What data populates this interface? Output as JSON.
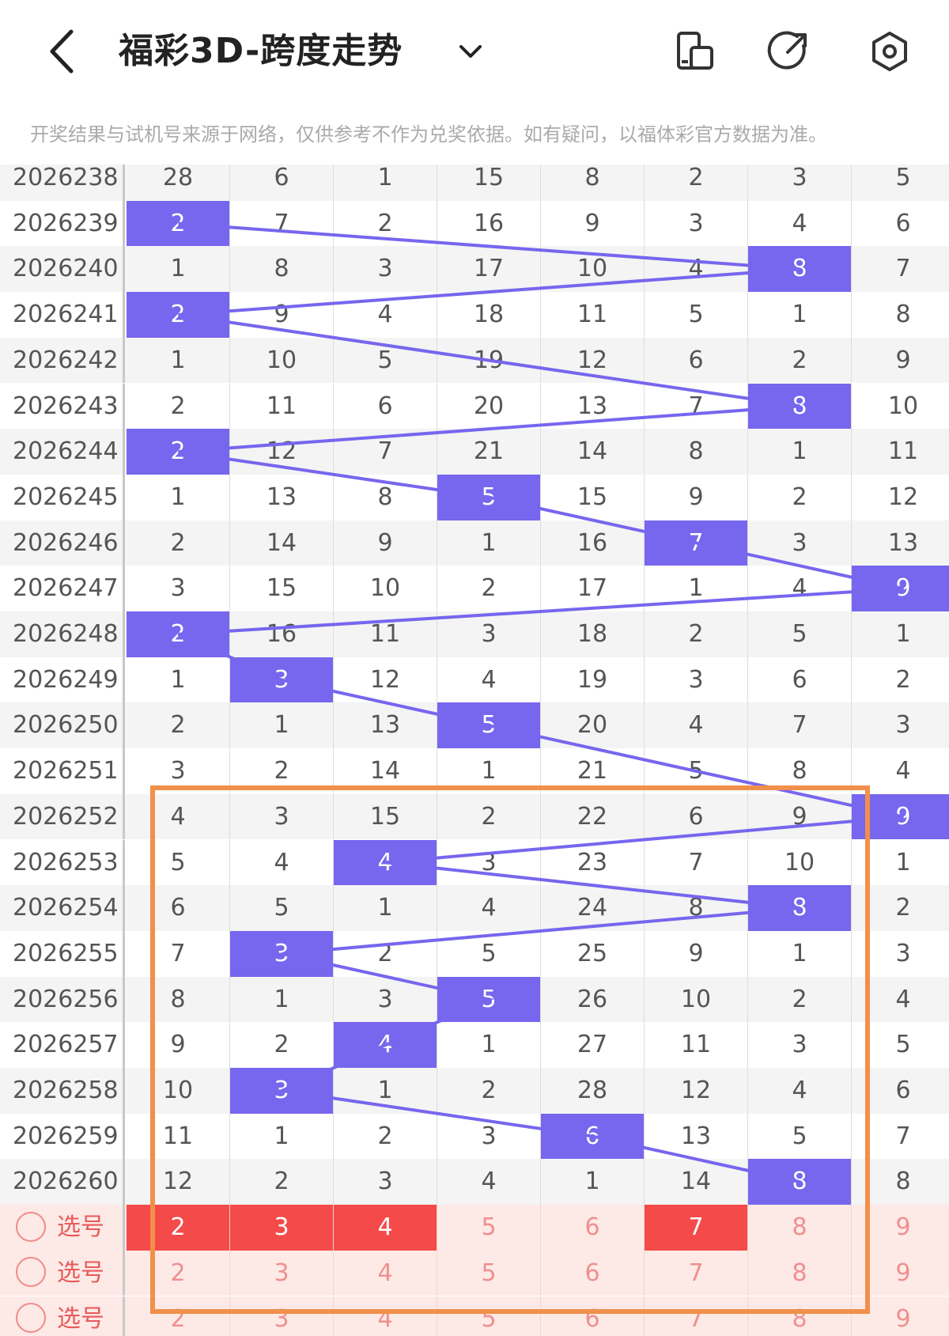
{
  "header": {
    "title": "福彩3D-跨度走势",
    "notice": "开奖结果与试机号来源于网络，仅供参考不作为兑奖依据。如有疑问，以福体彩官方数据为准。"
  },
  "rows": [
    {
      "issue": "2026238",
      "values": [
        28,
        6,
        1,
        15,
        8,
        2,
        3,
        5
      ]
    },
    {
      "issue": "2026239",
      "values": [
        2,
        7,
        2,
        16,
        9,
        3,
        4,
        6
      ]
    },
    {
      "issue": "2026240",
      "values": [
        1,
        8,
        3,
        17,
        10,
        4,
        8,
        7
      ]
    },
    {
      "issue": "2026241",
      "values": [
        2,
        9,
        4,
        18,
        11,
        5,
        1,
        8
      ]
    },
    {
      "issue": "2026242",
      "values": [
        1,
        10,
        5,
        19,
        12,
        6,
        2,
        9
      ]
    },
    {
      "issue": "2026243",
      "values": [
        2,
        11,
        6,
        20,
        13,
        7,
        8,
        10
      ]
    },
    {
      "issue": "2026244",
      "values": [
        2,
        12,
        7,
        21,
        14,
        8,
        1,
        11
      ]
    },
    {
      "issue": "2026245",
      "values": [
        1,
        13,
        8,
        5,
        15,
        9,
        2,
        12
      ]
    },
    {
      "issue": "2026246",
      "values": [
        2,
        14,
        9,
        1,
        16,
        7,
        3,
        13
      ]
    },
    {
      "issue": "2026247",
      "values": [
        3,
        15,
        10,
        2,
        17,
        1,
        4,
        9
      ]
    },
    {
      "issue": "2026248",
      "values": [
        2,
        16,
        11,
        3,
        18,
        2,
        5,
        1
      ]
    },
    {
      "issue": "2026249",
      "values": [
        1,
        3,
        12,
        4,
        19,
        3,
        6,
        2
      ]
    },
    {
      "issue": "2026250",
      "values": [
        2,
        1,
        13,
        5,
        20,
        4,
        7,
        3
      ]
    },
    {
      "issue": "2026251",
      "values": [
        3,
        2,
        14,
        1,
        21,
        5,
        8,
        4
      ]
    },
    {
      "issue": "2026252",
      "values": [
        4,
        3,
        15,
        2,
        22,
        6,
        9,
        9
      ]
    },
    {
      "issue": "2026253",
      "values": [
        5,
        4,
        4,
        3,
        23,
        7,
        10,
        1
      ]
    },
    {
      "issue": "2026254",
      "values": [
        6,
        5,
        1,
        4,
        24,
        8,
        8,
        2
      ]
    },
    {
      "issue": "2026255",
      "values": [
        7,
        3,
        2,
        5,
        25,
        9,
        1,
        3
      ]
    },
    {
      "issue": "2026256",
      "values": [
        8,
        1,
        3,
        5,
        26,
        10,
        2,
        4
      ]
    },
    {
      "issue": "2026257",
      "values": [
        9,
        2,
        4,
        1,
        27,
        11,
        3,
        5
      ]
    },
    {
      "issue": "2026258",
      "values": [
        10,
        3,
        1,
        2,
        28,
        12,
        4,
        6
      ]
    },
    {
      "issue": "2026259",
      "values": [
        11,
        1,
        2,
        3,
        6,
        13,
        5,
        7
      ]
    },
    {
      "issue": "2026260",
      "values": [
        12,
        2,
        3,
        4,
        1,
        14,
        8,
        8
      ]
    }
  ],
  "hits": [
    null,
    0,
    6,
    0,
    null,
    6,
    0,
    3,
    5,
    7,
    0,
    1,
    3,
    null,
    7,
    2,
    6,
    1,
    3,
    2,
    1,
    4,
    6
  ],
  "pick_rows": [
    {
      "label": "选号",
      "values": [
        2,
        3,
        4,
        5,
        6,
        7,
        8,
        9
      ],
      "selected": [
        0,
        1,
        2,
        5
      ]
    },
    {
      "label": "选号",
      "values": [
        2,
        3,
        4,
        5,
        6,
        7,
        8,
        9
      ],
      "selected": []
    },
    {
      "label": "选号",
      "values": [
        2,
        3,
        4,
        5,
        6,
        7,
        8,
        9
      ],
      "selected": []
    }
  ],
  "colors": {
    "hit": "#7766ee",
    "selected": "#f44a4a",
    "frame": "#f0904a"
  }
}
